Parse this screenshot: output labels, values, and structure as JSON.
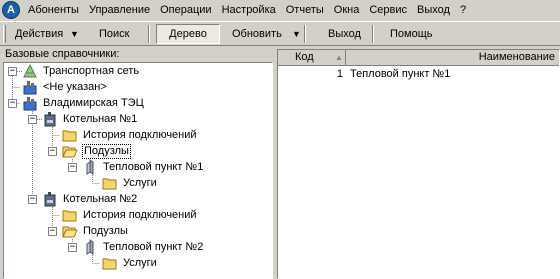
{
  "menu": [
    "Абоненты",
    "Управление",
    "Операции",
    "Настройка",
    "Отчеты",
    "Окна",
    "Сервис",
    "Выход",
    "?"
  ],
  "toolbar": {
    "actions": "Действия",
    "search": "Поиск",
    "tree": "Дерево",
    "refresh": "Обновить",
    "exit": "Выход",
    "help": "Помощь"
  },
  "left_panel_title": "Базовые справочники:",
  "tree": {
    "root": "Транспортная сеть",
    "not_specified": "<Не указан>",
    "tec": "Владимирская ТЭЦ",
    "boiler1": "Котельная №1",
    "history1": "История подключений",
    "substations1": "Подузлы",
    "point1": "Тепловой пункт №1",
    "services1": "Услуги",
    "boiler2": "Котельная №2",
    "history2": "История подключений",
    "substations2": "Подузлы",
    "point2": "Тепловой пункт №2",
    "services2": "Услуги"
  },
  "grid": {
    "col_code": "Код",
    "col_name": "Наименование",
    "rows": [
      {
        "code": "1",
        "name": "Тепловой пункт №1"
      }
    ]
  }
}
